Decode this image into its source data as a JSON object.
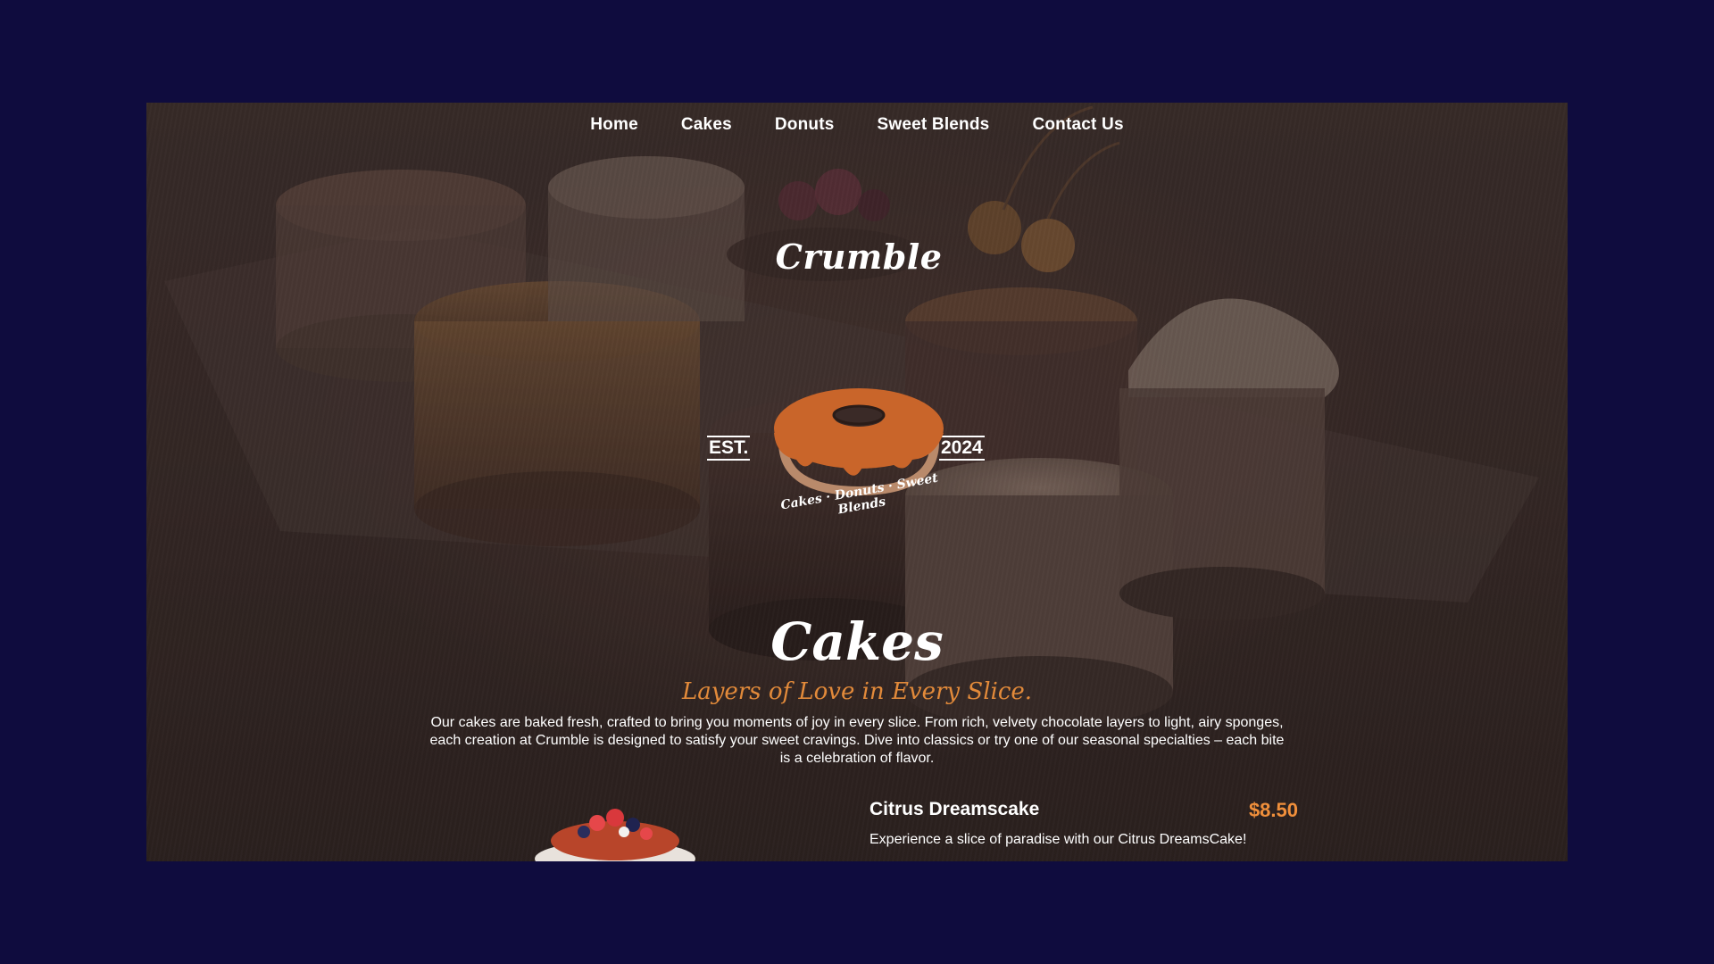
{
  "nav": {
    "items": [
      {
        "label": "Home"
      },
      {
        "label": "Cakes"
      },
      {
        "label": "Donuts"
      },
      {
        "label": "Sweet Blends"
      },
      {
        "label": "Contact Us"
      }
    ]
  },
  "logo": {
    "brand": "Crumble",
    "est": "EST.",
    "year": "2024",
    "tagline": "Cakes · Donuts · Sweet Blends"
  },
  "hero": {
    "title": "Cakes",
    "subtitle": "Layers of Love in Every Slice.",
    "description": "Our cakes are baked fresh, crafted to bring you moments of joy in every slice. From rich, velvety chocolate layers to light, airy sponges, each creation at Crumble is designed to satisfy your sweet cravings. Dive into classics or try one of our seasonal specialties – each bite is a celebration of flavor."
  },
  "menu": {
    "items": [
      {
        "name": "Citrus Dreamscake",
        "price": "$8.50",
        "description": "Experience a slice of paradise with our Citrus DreamsCake!"
      }
    ]
  },
  "colors": {
    "background": "#0f0c3e",
    "accent": "#e28a3a",
    "donut": "#c9652a"
  }
}
